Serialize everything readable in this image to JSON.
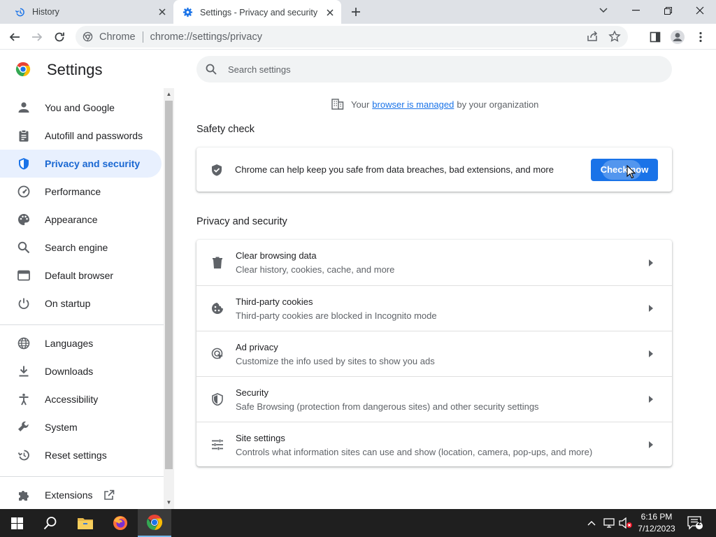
{
  "browser": {
    "tabs": [
      {
        "title": "History",
        "icon": "history-icon",
        "active": false
      },
      {
        "title": "Settings - Privacy and security",
        "icon": "gear-icon",
        "active": true
      }
    ],
    "omnibox": {
      "site_label": "Chrome",
      "url": "chrome://settings/privacy"
    }
  },
  "settings": {
    "title": "Settings",
    "search_placeholder": "Search settings"
  },
  "sidebar": {
    "items": [
      {
        "label": "You and Google",
        "icon": "person-icon"
      },
      {
        "label": "Autofill and passwords",
        "icon": "clipboard-icon"
      },
      {
        "label": "Privacy and security",
        "icon": "shield-icon",
        "active": true
      },
      {
        "label": "Performance",
        "icon": "speedometer-icon"
      },
      {
        "label": "Appearance",
        "icon": "palette-icon"
      },
      {
        "label": "Search engine",
        "icon": "search-icon"
      },
      {
        "label": "Default browser",
        "icon": "browser-window-icon"
      },
      {
        "label": "On startup",
        "icon": "power-icon"
      },
      {
        "label": "Languages",
        "icon": "globe-icon"
      },
      {
        "label": "Downloads",
        "icon": "download-icon"
      },
      {
        "label": "Accessibility",
        "icon": "accessibility-icon"
      },
      {
        "label": "System",
        "icon": "wrench-icon"
      },
      {
        "label": "Reset settings",
        "icon": "reset-icon"
      },
      {
        "label": "Extensions",
        "icon": "puzzle-icon"
      }
    ]
  },
  "managed": {
    "prefix": "Your",
    "link": "browser is managed",
    "suffix": "by your organization"
  },
  "safety_check": {
    "section_title": "Safety check",
    "text": "Chrome can help keep you safe from data breaches, bad extensions, and more",
    "button": "Check now"
  },
  "privacy": {
    "section_title": "Privacy and security",
    "rows": [
      {
        "title": "Clear browsing data",
        "subtitle": "Clear history, cookies, cache, and more",
        "icon": "trash-icon"
      },
      {
        "title": "Third-party cookies",
        "subtitle": "Third-party cookies are blocked in Incognito mode",
        "icon": "cookie-icon"
      },
      {
        "title": "Ad privacy",
        "subtitle": "Customize the info used by sites to show you ads",
        "icon": "ad-privacy-icon"
      },
      {
        "title": "Security",
        "subtitle": "Safe Browsing (protection from dangerous sites) and other security settings",
        "icon": "shield-outline-icon"
      },
      {
        "title": "Site settings",
        "subtitle": "Controls what information sites can use and show (location, camera, pop-ups, and more)",
        "icon": "tune-icon"
      }
    ]
  },
  "taskbar": {
    "time": "6:16 PM",
    "date": "7/12/2023",
    "notifications": "2"
  },
  "colors": {
    "accent": "#1a73e8",
    "active_nav_bg": "#e8f0fe",
    "taskbar_bg": "#1f1f1f"
  }
}
